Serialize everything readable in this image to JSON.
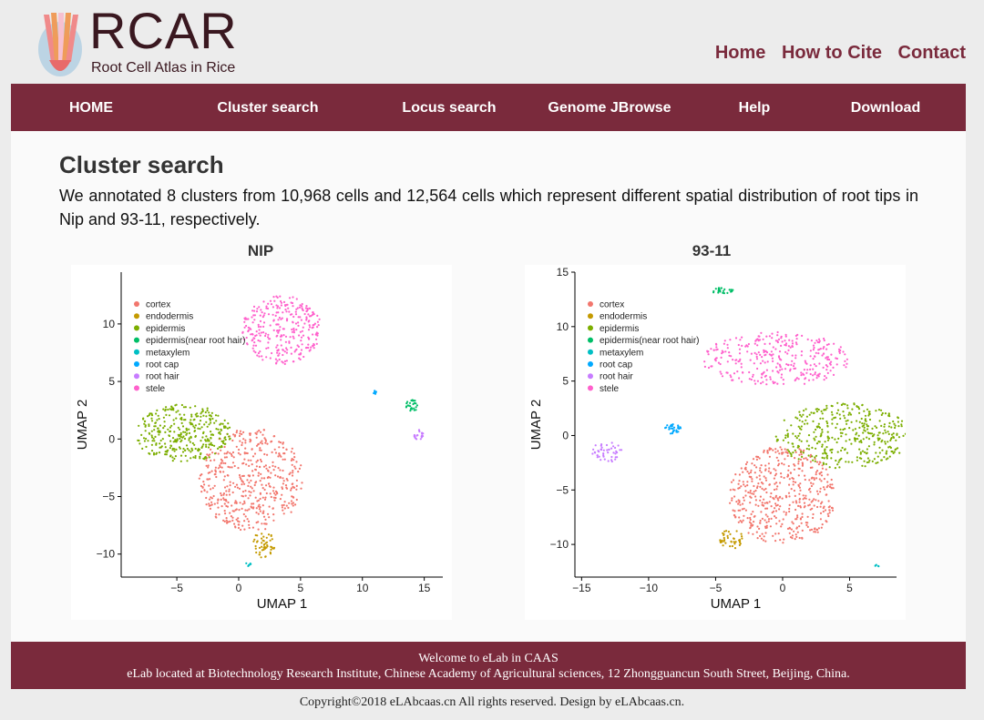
{
  "brand": {
    "title": "RCAR",
    "subtitle": "Root Cell Atlas in Rice"
  },
  "top_links": [
    "Home",
    "How to Cite",
    "Contact"
  ],
  "nav": [
    "HOME",
    "Cluster search",
    "Locus search",
    "Genome JBrowse",
    "Help",
    "Download"
  ],
  "main": {
    "title": "Cluster search",
    "description": "We annotated 8 clusters from 10,968 cells and 12,564 cells which represent different spatial distribution of root tips in Nip and 93-11, respectively."
  },
  "colors": {
    "primary": "#7a2a3c"
  },
  "legend": [
    {
      "label": "cortex",
      "color": "#f2766d"
    },
    {
      "label": "endodermis",
      "color": "#c49a00"
    },
    {
      "label": "epidermis",
      "color": "#7cae00"
    },
    {
      "label": "epidermis(near root hair)",
      "color": "#00be67"
    },
    {
      "label": "metaxylem",
      "color": "#00bfc4"
    },
    {
      "label": "root cap",
      "color": "#00a9ff"
    },
    {
      "label": "root hair",
      "color": "#c77cff"
    },
    {
      "label": "stele",
      "color": "#ff61cc"
    }
  ],
  "chart_data": [
    {
      "type": "scatter",
      "title": "NIP",
      "xlabel": "UMAP 1",
      "ylabel": "UMAP 2",
      "xlim": [
        -9.5,
        16.5
      ],
      "ylim": [
        -12,
        14.5
      ],
      "xticks": [
        -5,
        0,
        5,
        10,
        15
      ],
      "yticks": [
        -10,
        -5,
        0,
        5,
        10
      ],
      "legend_position": "top-left",
      "clusters": [
        {
          "name": "cortex",
          "cx": 1.0,
          "cy": -3.5,
          "rx": 4.2,
          "ry": 4.5,
          "n": 480
        },
        {
          "name": "epidermis",
          "cx": -4.5,
          "cy": 0.5,
          "rx": 4.0,
          "ry": 2.5,
          "n": 340
        },
        {
          "name": "stele",
          "cx": 3.5,
          "cy": 9.5,
          "rx": 3.2,
          "ry": 3.0,
          "n": 300
        },
        {
          "name": "endodermis",
          "cx": 2.0,
          "cy": -9.2,
          "rx": 0.9,
          "ry": 1.2,
          "n": 50
        },
        {
          "name": "epidermis(near root hair)",
          "cx": 14.0,
          "cy": 2.9,
          "rx": 0.5,
          "ry": 0.5,
          "n": 25
        },
        {
          "name": "root hair",
          "cx": 14.6,
          "cy": 0.3,
          "rx": 0.4,
          "ry": 0.5,
          "n": 20
        },
        {
          "name": "root cap",
          "cx": 11.0,
          "cy": 4.1,
          "rx": 0.2,
          "ry": 0.2,
          "n": 6
        },
        {
          "name": "metaxylem",
          "cx": 0.8,
          "cy": -10.8,
          "rx": 0.2,
          "ry": 0.3,
          "n": 6
        }
      ]
    },
    {
      "type": "scatter",
      "title": "93-11",
      "xlabel": "UMAP 1",
      "ylabel": "UMAP 2",
      "xlim": [
        -15.5,
        8.5
      ],
      "ylim": [
        -13,
        15
      ],
      "xticks": [
        -15,
        -10,
        -5,
        0,
        5
      ],
      "yticks": [
        -10,
        -5,
        0,
        5,
        10,
        15
      ],
      "legend_position": "top-left",
      "clusters": [
        {
          "name": "cortex",
          "cx": 0.0,
          "cy": -5.5,
          "rx": 4.0,
          "ry": 4.5,
          "n": 480
        },
        {
          "name": "epidermis",
          "cx": 4.5,
          "cy": 0.0,
          "rx": 5.0,
          "ry": 3.0,
          "n": 380
        },
        {
          "name": "stele",
          "cx": -0.5,
          "cy": 7.0,
          "rx": 5.5,
          "ry": 2.5,
          "n": 320
        },
        {
          "name": "endodermis",
          "cx": -3.8,
          "cy": -9.5,
          "rx": 0.9,
          "ry": 0.9,
          "n": 40
        },
        {
          "name": "epidermis(near root hair)",
          "cx": -4.5,
          "cy": 13.3,
          "rx": 0.8,
          "ry": 0.3,
          "n": 25
        },
        {
          "name": "root hair",
          "cx": -13.0,
          "cy": -1.5,
          "rx": 1.2,
          "ry": 1.0,
          "n": 45
        },
        {
          "name": "root cap",
          "cx": -8.2,
          "cy": 0.6,
          "rx": 0.6,
          "ry": 0.5,
          "n": 30
        },
        {
          "name": "metaxylem",
          "cx": 7.0,
          "cy": -12.0,
          "rx": 0.2,
          "ry": 0.15,
          "n": 5
        }
      ]
    }
  ],
  "footer": {
    "line1": "Welcome to eLab in CAAS",
    "line2": "eLab located at Biotechnology Research Institute, Chinese Academy of Agricultural sciences, 12 Zhongguancun South Street, Beijing, China."
  },
  "copyright": "Copyright©2018 eLAbcaas.cn All rights reserved. Design by eLAbcaas.cn."
}
